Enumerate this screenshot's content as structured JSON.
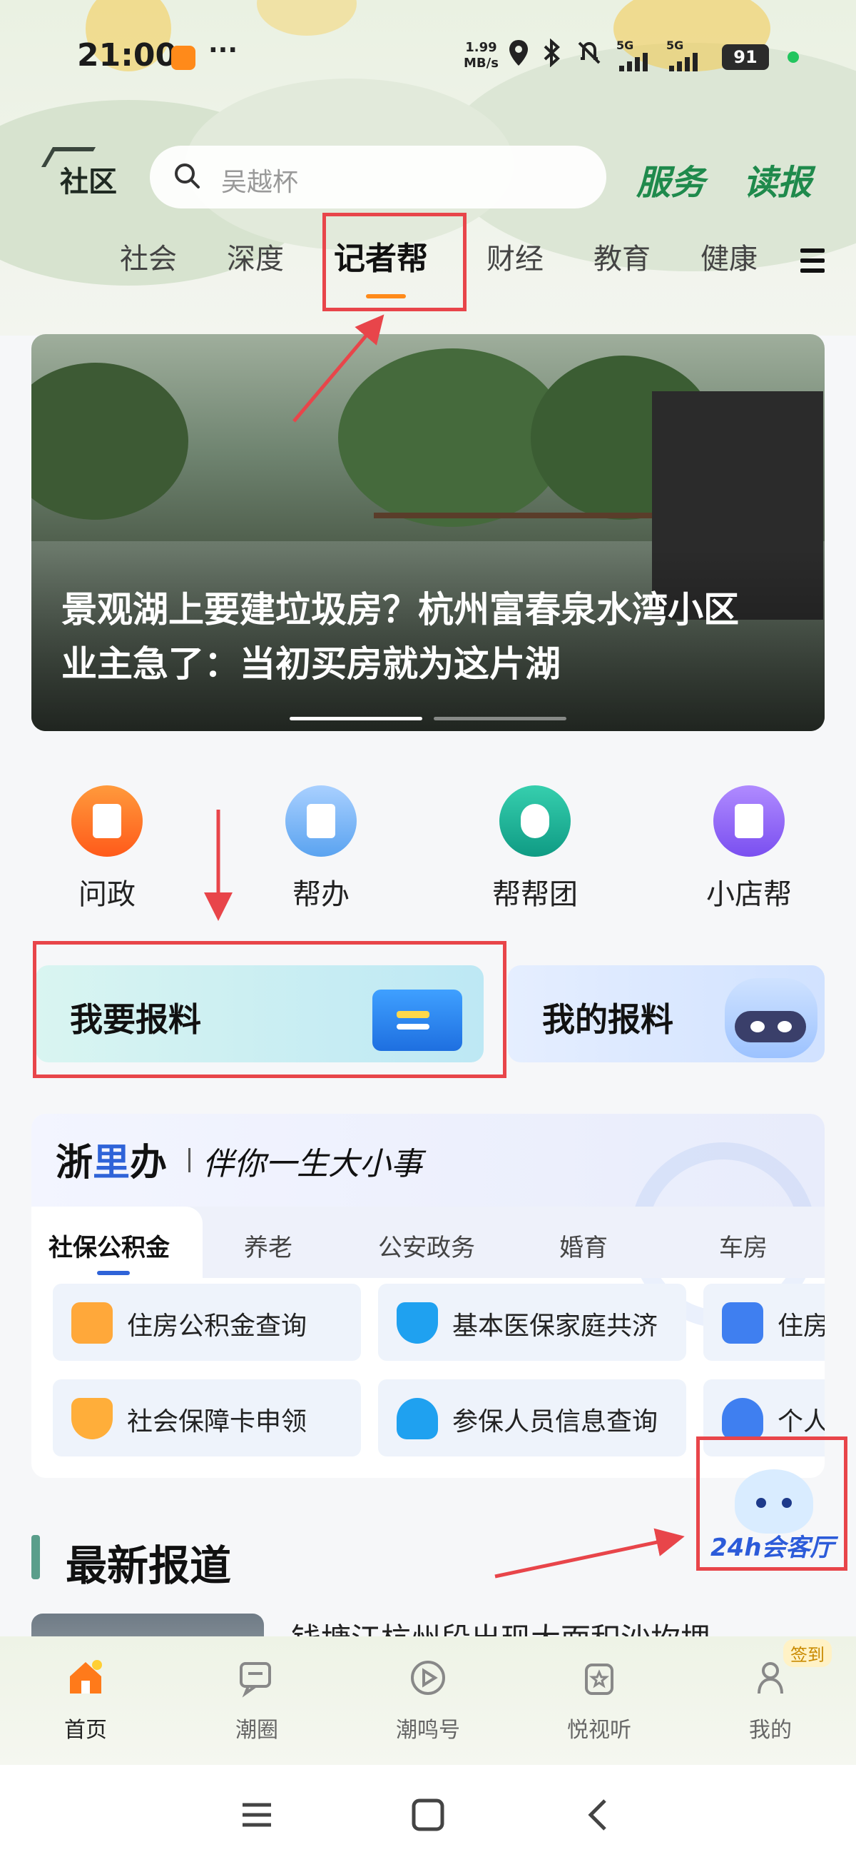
{
  "status_bar": {
    "time": "21:00",
    "dots": "···",
    "net_speed_value": "1.99",
    "net_speed_unit": "MB/s",
    "signal_1": "5G",
    "signal_2": "5G",
    "battery": "91"
  },
  "header": {
    "logo_text": "社区",
    "search_placeholder": "吴越杯",
    "link_service": "服务",
    "link_newspaper": "读报"
  },
  "tabs": [
    "社会",
    "深度",
    "记者帮",
    "财经",
    "教育",
    "健康"
  ],
  "banner": {
    "title_line1": "景观湖上要建垃圾房？杭州富春泉水湾小区",
    "title_line2": "业主急了：当初买房就为这片湖"
  },
  "quick_actions": [
    {
      "label": "问政",
      "color": "#ff6a1a"
    },
    {
      "label": "帮办",
      "color": "#5aa3f0"
    },
    {
      "label": "帮帮团",
      "color": "#18b39a"
    },
    {
      "label": "小店帮",
      "color": "#8a5cf0"
    }
  ],
  "report_cards": {
    "submit": "我要报料",
    "mine": "我的报料"
  },
  "zheliban": {
    "brand_1": "浙",
    "brand_2": "里",
    "brand_3": "办",
    "slogan": "伴你一生大小事",
    "tabs": [
      "社保公积金",
      "养老",
      "公安政务",
      "婚育",
      "车房"
    ],
    "services": [
      {
        "label": "住房公积金查询",
        "color": "#ff9a2e"
      },
      {
        "label": "基本医保家庭共济",
        "color": "#1fa1f0"
      },
      {
        "label": "住房",
        "color": "#3f7ff0"
      },
      {
        "label": "社会保障卡申领",
        "color": "#ffaa2e"
      },
      {
        "label": "参保人员信息查询",
        "color": "#1fa1f0"
      },
      {
        "label": "个人",
        "color": "#3f7ff0"
      }
    ]
  },
  "news": {
    "section_title": "最新报道",
    "first_headline": "钱塘江杭州段出现大面积沙坎埋"
  },
  "assistant": {
    "label": "24h会客厅"
  },
  "bottom_nav": [
    {
      "label": "首页"
    },
    {
      "label": "潮圈"
    },
    {
      "label": "潮鸣号"
    },
    {
      "label": "悦视听"
    },
    {
      "label": "我的"
    }
  ],
  "signin_badge": "签到",
  "colors": {
    "accent": "#ff8a1a",
    "annotation_red": "#e8454a",
    "brand_green": "#1f8a4c",
    "zlb_blue": "#2f63d8"
  }
}
